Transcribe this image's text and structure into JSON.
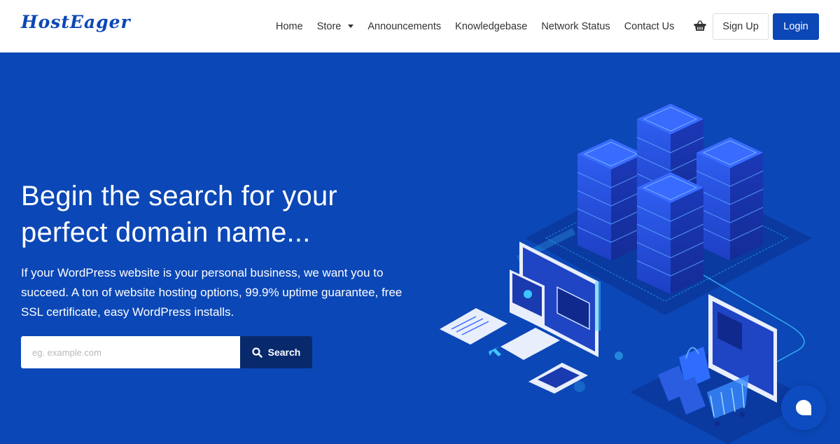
{
  "header": {
    "logo": "HostEager",
    "nav": [
      {
        "label": "Home"
      },
      {
        "label": "Store",
        "has_dropdown": true
      },
      {
        "label": "Announcements"
      },
      {
        "label": "Knowledgebase"
      },
      {
        "label": "Network Status"
      },
      {
        "label": "Contact Us"
      }
    ],
    "cart_icon": "shopping-basket-icon",
    "signup_label": "Sign Up",
    "login_label": "Login"
  },
  "hero": {
    "title": "Begin the search for your perfect domain name...",
    "description": "If your WordPress website is your personal business, we want you to succeed. A ton of website hosting options, 99.9% uptime guarantee, free SSL certificate, easy WordPress installs.",
    "search": {
      "value": "",
      "placeholder": "eg. example.com",
      "button_label": "Search",
      "button_icon": "search-icon"
    },
    "illustration": "isometric-server-hosting-illustration"
  },
  "chat_widget": {
    "icon": "chat-bubble-icon"
  },
  "colors": {
    "brand": "#0b47b6",
    "hero_bg": "#0b47b6",
    "search_button": "#082a6c",
    "header_bg": "#ffffff",
    "nav_text": "#333333"
  }
}
